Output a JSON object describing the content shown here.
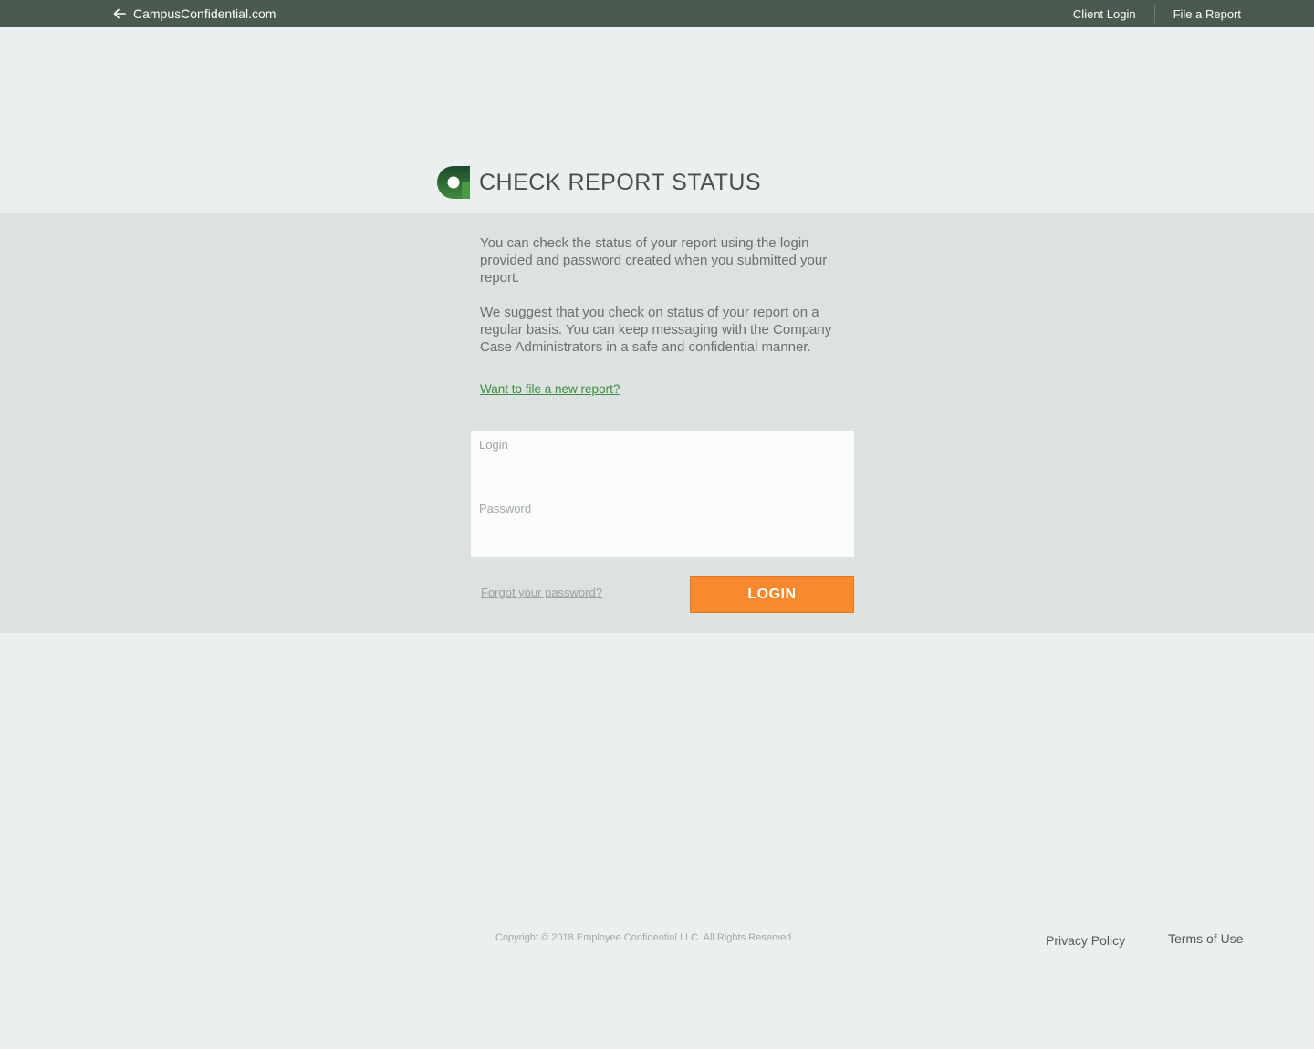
{
  "topbar": {
    "back_label": "CampusConfidential.com",
    "nav": {
      "client_login": "Client Login",
      "file_report": "File a Report"
    },
    "background_color": "#4a5a4e"
  },
  "page": {
    "title": "CHECK REPORT STATUS",
    "intro_paragraphs": [
      "You can check the status of your report using the login provided and password created when you submitted your report.",
      "We suggest that you check on status of your report on a regular basis. You can keep messaging with the Company Case Administrators in a safe and confidential manner."
    ],
    "new_report_link": "Want to file a new report?"
  },
  "form": {
    "login_label": "Login",
    "login_value": "",
    "password_label": "Password",
    "password_value": "",
    "forgot_link": "Forgot your password?",
    "submit_label": "LOGIN",
    "submit_color": "#f78a2f"
  },
  "footer": {
    "copyright": "Copyright © 2018 Employee Confidential LLC. All Rights Reserved",
    "privacy": "Privacy Policy",
    "terms": "Terms of Use"
  },
  "icons": {
    "back": "arrow-left-icon",
    "logo": "campus-confidential-logo-icon"
  }
}
